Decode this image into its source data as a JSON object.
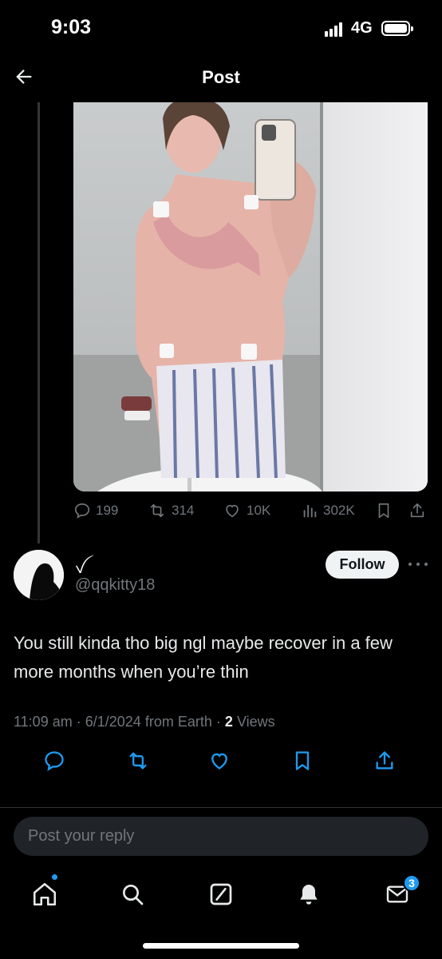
{
  "status_bar": {
    "time": "9:03",
    "network": "4G"
  },
  "header": {
    "title": "Post"
  },
  "post": {
    "engagement": {
      "replies": "199",
      "reposts": "314",
      "likes": "10K",
      "views": "302K"
    }
  },
  "reply": {
    "display_name": "ꪜ",
    "handle": "@qqkitty18",
    "follow_label": "Follow",
    "text": "You still kinda tho big ngl maybe recover in a few more months when you’re thin",
    "meta": {
      "time": "11:09 am",
      "date": "6/1/2024",
      "source": "from Earth",
      "views_count": "2",
      "views_label": "Views",
      "sep": "·"
    }
  },
  "compose": {
    "placeholder": "Post your reply"
  },
  "tab_bar": {
    "messages_badge": "3"
  },
  "colors": {
    "accent": "#1d9bf0",
    "muted": "#71767b",
    "background": "#000000"
  }
}
